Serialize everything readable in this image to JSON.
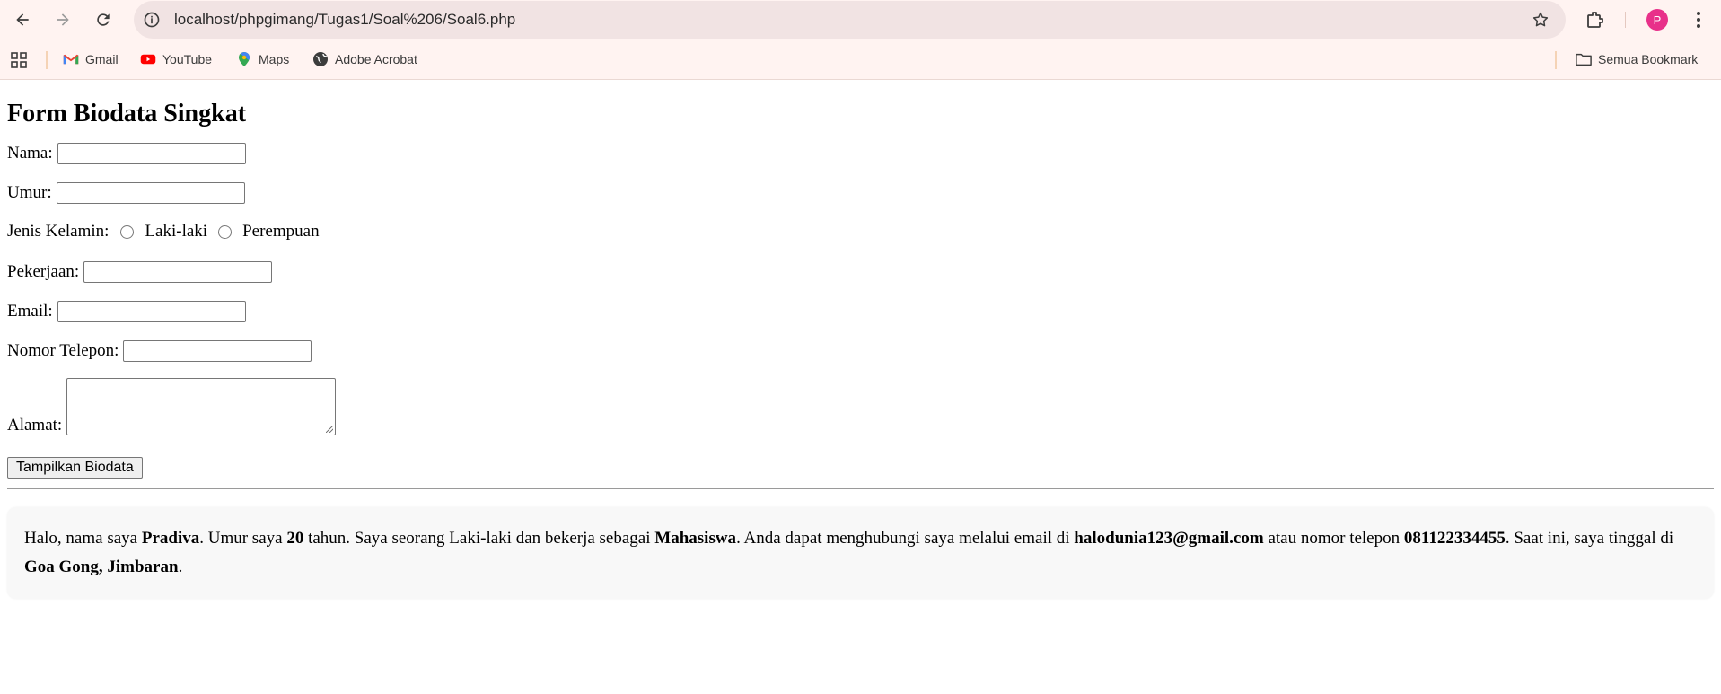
{
  "browser": {
    "url": "localhost/phpgimang/Tugas1/Soal%206/Soal6.php",
    "avatar_letter": "P",
    "bookmarks": [
      "Gmail",
      "YouTube",
      "Maps",
      "Adobe Acrobat"
    ],
    "all_bookmarks_label": "Semua Bookmark"
  },
  "page": {
    "title": "Form Biodata Singkat",
    "fields": {
      "nama": "Nama:",
      "umur": "Umur:",
      "jenis_kelamin": "Jenis Kelamin:",
      "laki": "Laki-laki",
      "perempuan": "Perempuan",
      "pekerjaan": "Pekerjaan:",
      "email": "Email:",
      "telepon": "Nomor Telepon:",
      "alamat": "Alamat:"
    },
    "submit_label": "Tampilkan Biodata",
    "result": {
      "t1": "Halo, nama saya ",
      "nama": "Pradiva",
      "t2": ". Umur saya ",
      "umur": "20",
      "t3": " tahun. Saya seorang Laki-laki dan bekerja sebagai ",
      "pekerjaan": "Mahasiswa",
      "t4": ". Anda dapat menghubungi saya melalui email di ",
      "email": "halodunia123@gmail.com",
      "t5": " atau nomor telepon ",
      "telepon": "081122334455",
      "t6": ". Saat ini, saya tinggal di ",
      "alamat": "Goa Gong, Jimbaran",
      "t7": "."
    }
  }
}
